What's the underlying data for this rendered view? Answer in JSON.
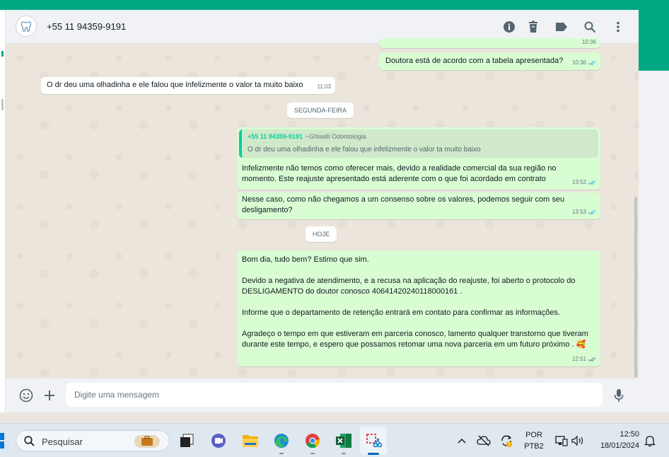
{
  "header": {
    "contact_name": "+55 11 94359-9191"
  },
  "icons": {
    "info": "info-icon",
    "delete": "trash-icon",
    "label": "label-icon",
    "search": "search-icon",
    "menu": "menu-icon",
    "emoji": "emoji-icon",
    "attach": "plus-icon",
    "mic": "mic-icon"
  },
  "messages": {
    "partial_time": "10:36",
    "m1": {
      "text": "Doutora está de acordo com a tabela apresentada?",
      "time": "10:36"
    },
    "m2": {
      "text": "O dr deu uma olhadinha e ele falou que infelizmente o valor ta muito baixo",
      "time": "11:03"
    },
    "date1": "SEGUNDA-FEIRA",
    "m3": {
      "quote_author": "+55 11 94359-9191",
      "quote_sub": "~Ghiselli Odontologia",
      "quote_text": "O dr deu uma olhadinha e ele falou que infelizmente o valor ta muito baixo",
      "text": "Infelizmente não temos como oferecer mais, devido a realidade comercial da sua região no momento. Este reajuste apresentado está aderente com o que foi acordado em contrato",
      "time": "13:52"
    },
    "m4": {
      "text": "Nesse caso, como não chegamos a um consenso sobre os valores, podemos seguir com seu desligamento?",
      "time": "13:53"
    },
    "date2": "HOJE",
    "m5": {
      "text": "Bom dia, tudo bem? Estimo que sim.\n\nDevido a negativa de atendimento, e a recusa na aplicação do reajuste, foi aberto o protocolo do DESLIGAMENTO do doutor conosco 40641420240118000161 .\n\nInforme que o departamento de retenção entrará em contato para confirmar as informações.\n\nAgradeço o tempo em que estiveram em parceria conosco, lamento qualquer transtorno que tiveram durante este tempo, e espero que possamos retomar uma nova parceria em um futuro próximo .",
      "emoji": "🥰",
      "time": "12:51"
    }
  },
  "composer": {
    "placeholder": "Digite uma mensagem"
  },
  "taskbar": {
    "search_label": "Pesquisar",
    "lang_top": "POR",
    "lang_bottom": "PTB2",
    "time": "12:50",
    "date": "18/01/2024"
  },
  "colors": {
    "brand": "#00a884",
    "outgoing_bubble": "#d9fdd3",
    "incoming_bubble": "#ffffff",
    "read_tick": "#53bdeb"
  }
}
